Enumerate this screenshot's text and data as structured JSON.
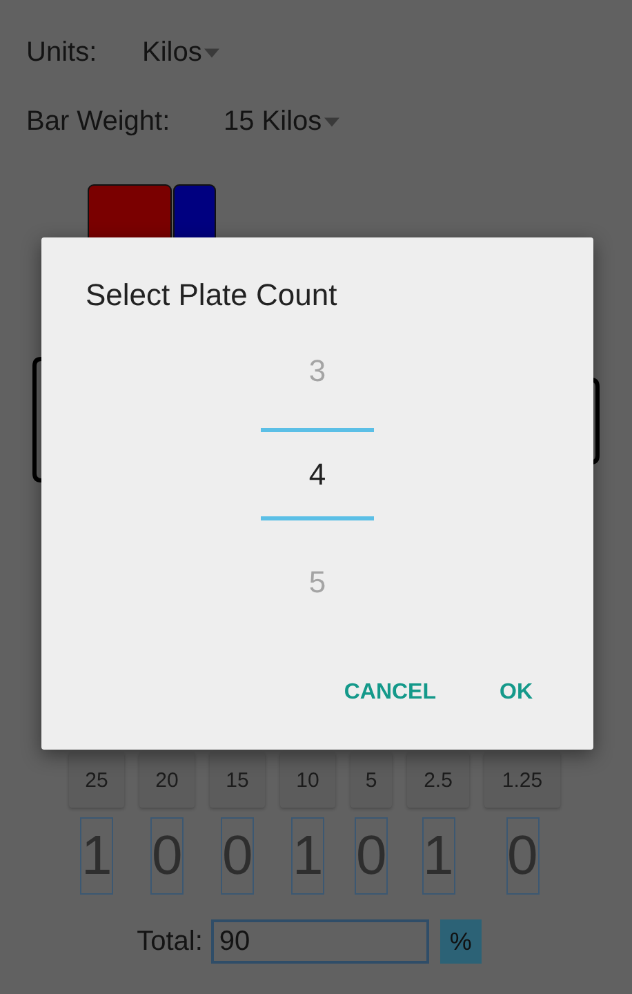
{
  "units": {
    "label": "Units:",
    "value": "Kilos"
  },
  "bar_weight": {
    "label": "Bar Weight:",
    "value": "15 Kilos"
  },
  "loaded_plates": [
    {
      "color": "#7a0000"
    },
    {
      "color": "#000080"
    }
  ],
  "plate_buttons": [
    "25",
    "20",
    "15",
    "10",
    "5",
    "2.5",
    "1.25"
  ],
  "plate_counts": [
    "1",
    "0",
    "0",
    "1",
    "0",
    "1",
    "0"
  ],
  "total": {
    "label": "Total:",
    "value": "90"
  },
  "percent_button": "%",
  "dialog": {
    "title": "Select Plate Count",
    "picker": [
      {
        "value": "3",
        "selected": false
      },
      {
        "value": "4",
        "selected": true
      },
      {
        "value": "5",
        "selected": false
      }
    ],
    "buttons": [
      "CANCEL",
      "OK"
    ]
  }
}
